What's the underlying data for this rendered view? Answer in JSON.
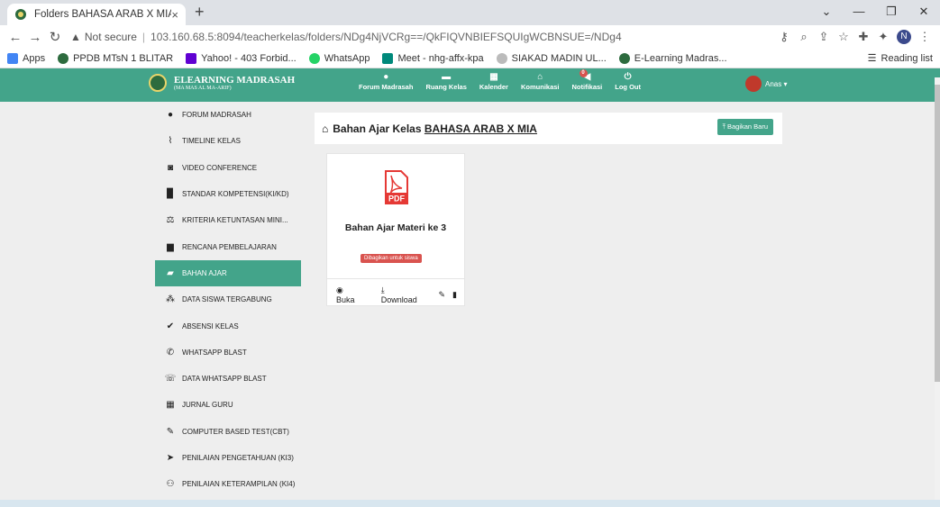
{
  "browser": {
    "tab_title": "Folders BAHASA ARAB X MIA",
    "tab_close": "×",
    "new_tab": "+",
    "url_warning": "Not secure",
    "url_separator": "|",
    "url": "103.160.68.5:8094/teacherkelas/folders/NDg4NjVCRg==/QkFIQVNBIEFSQUIgWCBNSUE=/NDg4",
    "profile_initial": "N"
  },
  "bookmarks": {
    "items": [
      {
        "label": "Apps"
      },
      {
        "label": "PPDB MTsN 1 BLITAR"
      },
      {
        "label": "Yahoo! - 403 Forbid..."
      },
      {
        "label": "WhatsApp"
      },
      {
        "label": "Meet - nhg-affx-kpa"
      },
      {
        "label": "SIAKAD MADIN UL..."
      },
      {
        "label": "E-Learning Madras..."
      }
    ],
    "reading_list": "Reading list"
  },
  "app": {
    "brand_name": "ELEARNING MADRASAH",
    "brand_sub": "(MA MAS AL MA-ARIF)",
    "nav": [
      {
        "label": "Forum Madrasah",
        "icon": "chat-icon"
      },
      {
        "label": "Ruang Kelas",
        "icon": "class-icon"
      },
      {
        "label": "Kalender",
        "icon": "calendar-icon"
      },
      {
        "label": "Komunikasi",
        "icon": "home-icon"
      },
      {
        "label": "Notifikasi",
        "icon": "megaphone-icon"
      },
      {
        "label": "Log Out",
        "icon": "power-icon"
      }
    ],
    "notif_count": "0",
    "user_name": "Anas ▾",
    "accent": "#43a48a"
  },
  "sidebar": {
    "items": [
      {
        "label": "FORUM MADRASAH",
        "icon": "users-chat-icon"
      },
      {
        "label": "TIMELINE KELAS",
        "icon": "rss-icon"
      },
      {
        "label": "VIDEO CONFERENCE",
        "icon": "camera-icon"
      },
      {
        "label": "STANDAR KOMPETENSI(KI/KD)",
        "icon": "book-icon"
      },
      {
        "label": "KRITERIA KETUNTASAN MINI...",
        "icon": "balance-icon"
      },
      {
        "label": "RENCANA PEMBELAJARAN",
        "icon": "briefcase-icon"
      },
      {
        "label": "BAHAN AJAR",
        "icon": "folder-open-icon"
      },
      {
        "label": "DATA SISWA TERGABUNG",
        "icon": "group-icon"
      },
      {
        "label": "ABSENSI KELAS",
        "icon": "check-icon"
      },
      {
        "label": "WHATSAPP BLAST",
        "icon": "phone-icon"
      },
      {
        "label": "DATA WHATSAPP BLAST",
        "icon": "phone-volume-icon"
      },
      {
        "label": "JURNAL GURU",
        "icon": "calendar-grid-icon"
      },
      {
        "label": "COMPUTER BASED TEST(CBT)",
        "icon": "edit-icon"
      },
      {
        "label": "PENILAIAN PENGETAHUAN (KI3)",
        "icon": "plane-icon"
      },
      {
        "label": "PENILAIAN KETERAMPILAN (KI4)",
        "icon": "users-icon"
      }
    ],
    "active_index": 6
  },
  "main": {
    "title_prefix": "Bahan Ajar Kelas",
    "title_class": "BAHASA ARAB X MIA",
    "share_button": "Bagikan Baru",
    "card": {
      "pdf_label": "PDF",
      "title": "Bahan Ajar Materi ke 3",
      "badge": "Dibagikan untuk siswa",
      "open": "Buka",
      "download": "Download"
    }
  }
}
